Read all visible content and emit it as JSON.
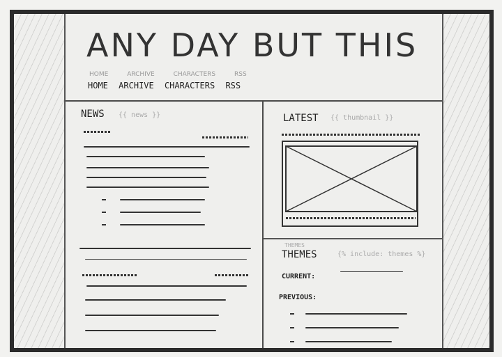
{
  "site": {
    "title": "ANY DAY BUT THIS"
  },
  "nav": {
    "faint_items": [
      "HOME",
      "ARCHIVE",
      "CHARACTERS",
      "RSS"
    ],
    "items": [
      "HOME",
      "ARCHIVE",
      "CHARACTERS",
      "RSS"
    ]
  },
  "news": {
    "label": "NEWS",
    "template_tag": "{{ news }}"
  },
  "latest": {
    "label": "LATEST",
    "template_tag": "{{ thumbnail }}"
  },
  "themes": {
    "faint_label": "THEMES",
    "label": "THEMES",
    "template_tag": "{% include: themes %}",
    "current_label": "CURRENT:",
    "previous_label": "PREVIOUS:"
  }
}
